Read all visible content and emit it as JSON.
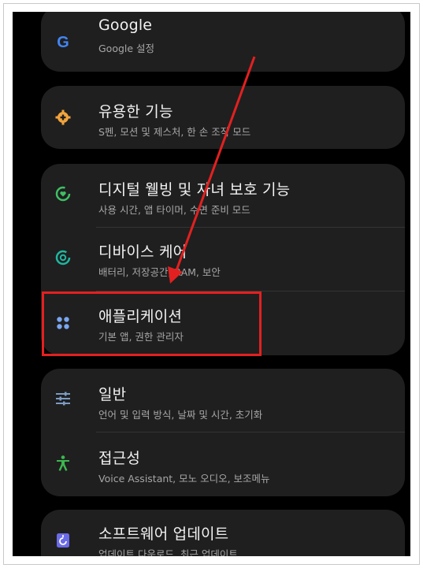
{
  "items": {
    "google": {
      "title": "Google",
      "subtitle": "Google 설정"
    },
    "advanced": {
      "title": "유용한 기능",
      "subtitle": "S펜, 모션 및 제스처, 한 손 조작 모드"
    },
    "wellbeing": {
      "title": "디지털 웰빙 및 자녀 보호 기능",
      "subtitle": "사용 시간, 앱 타이머, 수면 준비 모드"
    },
    "device_care": {
      "title": "디바이스 케어",
      "subtitle": "배터리, 저장공간, RAM, 보안"
    },
    "apps": {
      "title": "애플리케이션",
      "subtitle": "기본 앱, 권한 관리자"
    },
    "general": {
      "title": "일반",
      "subtitle": "언어 및 입력 방식, 날짜 및 시간, 초기화"
    },
    "accessibility": {
      "title": "접근성",
      "subtitle": "Voice Assistant, 모노 오디오, 보조메뉴"
    },
    "software_update": {
      "title": "소프트웨어 업데이트",
      "subtitle": "업데이트 다운로드, 최근 업데이트"
    }
  },
  "icons": {
    "google": "google-g-icon",
    "advanced": "gear-plus-icon",
    "wellbeing": "heart-ring-icon",
    "device_care": "care-ring-icon",
    "apps": "four-dots-icon",
    "general": "sliders-icon",
    "accessibility": "person-icon",
    "software_update": "update-icon"
  },
  "colors": {
    "screen_bg": "#000000",
    "card_bg": "#1f1f1f",
    "annotation_red": "#e32020",
    "google_blue": "#4285f4",
    "gear_orange": "#f1a43c",
    "wellbeing_green": "#3fbf63",
    "care_teal": "#1fb6a0",
    "apps_blue": "#7aa6f0",
    "general_blue": "#7c9bc2",
    "accessibility_green": "#3cb84f",
    "update_purple": "#6b6be8"
  }
}
